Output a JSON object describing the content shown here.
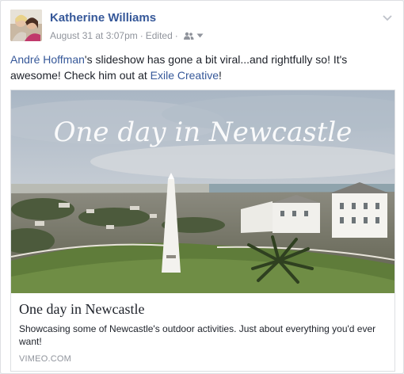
{
  "post": {
    "author": "Katherine Williams",
    "date": "August 31 at 3:07pm",
    "separator": "·",
    "edited": "Edited",
    "audience_icon": "friends-icon",
    "menu_icon": "chevron-down-icon",
    "text": {
      "mention": "André Hoffman",
      "part1": "'s slideshow has gone a bit viral...and rightfully so! It's awesome! Check him out at ",
      "page_link": "Exile Creative",
      "part2": "!"
    }
  },
  "attachment": {
    "overlay_title": "One day in Newcastle",
    "title": "One day in Newcastle",
    "description": "Showcasing some of Newcastle's outdoor activities. Just about everything you'd ever want!",
    "domain": "VIMEO.COM"
  },
  "colors": {
    "link": "#365899",
    "meta": "#90949c",
    "text": "#1d2129"
  }
}
